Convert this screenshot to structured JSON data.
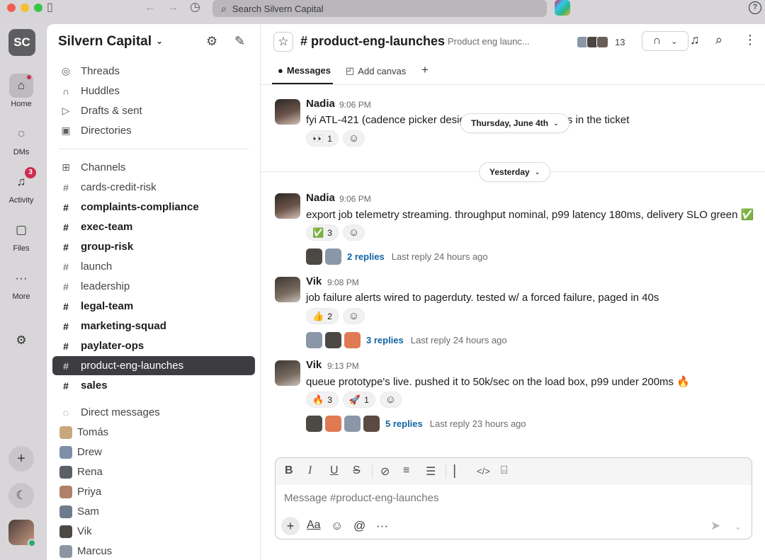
{
  "titlebar": {
    "search_placeholder": "Search Silvern Capital"
  },
  "rail": {
    "workspace_initials": "SC",
    "items": [
      {
        "label": "Home",
        "icon": "home-icon"
      },
      {
        "label": "DMs",
        "icon": "dms-icon"
      },
      {
        "label": "Activity",
        "icon": "bell-icon",
        "badge": "3"
      },
      {
        "label": "Files",
        "icon": "files-icon"
      },
      {
        "label": "More",
        "icon": "more-icon"
      }
    ]
  },
  "sidebar": {
    "workspace_name": "Silvern Capital",
    "nav": [
      {
        "label": "Threads",
        "icon": "threads-icon"
      },
      {
        "label": "Huddles",
        "icon": "headphones-icon"
      },
      {
        "label": "Drafts & sent",
        "icon": "send-icon"
      },
      {
        "label": "Directories",
        "icon": "directory-icon"
      }
    ],
    "channels_header": "Channels",
    "channels": [
      {
        "name": "cards-credit-risk",
        "bold": false,
        "active": false
      },
      {
        "name": "complaints-compliance",
        "bold": true,
        "active": false
      },
      {
        "name": "exec-team",
        "bold": true,
        "active": false
      },
      {
        "name": "group-risk",
        "bold": true,
        "active": false
      },
      {
        "name": "launch",
        "bold": false,
        "active": false
      },
      {
        "name": "leadership",
        "bold": false,
        "active": false
      },
      {
        "name": "legal-team",
        "bold": true,
        "active": false
      },
      {
        "name": "marketing-squad",
        "bold": true,
        "active": false
      },
      {
        "name": "paylater-ops",
        "bold": true,
        "active": false
      },
      {
        "name": "product-eng-launches",
        "bold": false,
        "active": true
      },
      {
        "name": "sales",
        "bold": true,
        "active": false
      }
    ],
    "dm_header": "Direct messages",
    "dms": [
      {
        "name": "Tomás",
        "color": "#c9a77d"
      },
      {
        "name": "Drew",
        "color": "#7e8fa8"
      },
      {
        "name": "Rena",
        "color": "#5b5f66"
      },
      {
        "name": "Priya",
        "color": "#b0806a"
      },
      {
        "name": "Sam",
        "color": "#6d7c8c"
      },
      {
        "name": "Vik",
        "color": "#4c4844"
      },
      {
        "name": "Marcus",
        "color": "#8c96a3"
      }
    ]
  },
  "channel": {
    "hash": "#",
    "name": "product-eng-launches",
    "description": "Product eng launc...",
    "member_count": "13",
    "tabs": {
      "messages": "Messages",
      "add_canvas": "Add canvas",
      "plus": "+"
    }
  },
  "dates": {
    "sticky": "Thursday, June 4th",
    "yesterday": "Yesterday"
  },
  "messages": [
    {
      "author": "Nadia",
      "time": "9:06 PM",
      "text_a": "fyi ATL-421 (cadence picker desig",
      "text_b": "s in the ticket",
      "reactions": [
        {
          "emoji": "👀",
          "count": "1"
        }
      ]
    },
    {
      "author": "Nadia",
      "time": "9:06 PM",
      "text": "export job telemetry streaming. throughput nominal, p99 latency 180ms, delivery SLO green ✅",
      "reactions": [
        {
          "emoji": "✅",
          "count": "3"
        }
      ],
      "thread": {
        "replies": "2 replies",
        "last": "Last reply 24 hours ago"
      }
    },
    {
      "author": "Vik",
      "time": "9:08 PM",
      "text": "job failure alerts wired to pagerduty. tested w/ a forced failure, paged in 40s",
      "reactions": [
        {
          "emoji": "👍",
          "count": "2"
        }
      ],
      "thread": {
        "replies": "3 replies",
        "last": "Last reply 24 hours ago"
      }
    },
    {
      "author": "Vik",
      "time": "9:13 PM",
      "text": "queue prototype's live. pushed it to 50k/sec on the load box, p99 under 200ms 🔥",
      "reactions": [
        {
          "emoji": "🔥",
          "count": "3"
        },
        {
          "emoji": "🚀",
          "count": "1"
        }
      ],
      "thread": {
        "replies": "5 replies",
        "last": "Last reply 23 hours ago"
      }
    }
  ],
  "composer": {
    "placeholder": "Message #product-eng-launches",
    "aa": "Aa"
  },
  "colors": {
    "accent_link": "#1264a3",
    "active_row": "#3d3c40",
    "badge": "#cc2c51"
  }
}
